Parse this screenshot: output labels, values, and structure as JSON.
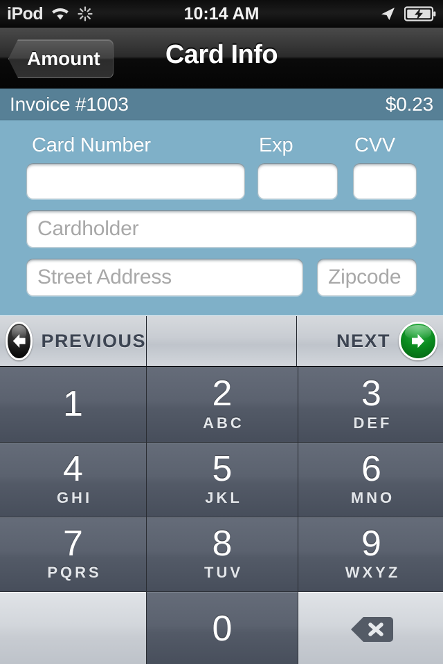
{
  "status_bar": {
    "carrier": "iPod",
    "wifi_icon": "wifi-icon",
    "activity_icon": "activity-spinner-icon",
    "time": "10:14 AM",
    "location_icon": "location-arrow-icon",
    "battery_icon": "battery-charging-icon"
  },
  "nav_bar": {
    "back_label": "Amount",
    "title": "Card Info"
  },
  "invoice": {
    "number": "Invoice #1003",
    "amount": "$0.23"
  },
  "form": {
    "labels": {
      "card_number": "Card Number",
      "exp": "Exp",
      "cvv": "CVV"
    },
    "fields": {
      "card_number_value": "",
      "card_number_placeholder": "",
      "exp_value": "",
      "exp_placeholder": "",
      "cvv_value": "",
      "cvv_placeholder": "",
      "cardholder_value": "",
      "cardholder_placeholder": "Cardholder",
      "street_value": "",
      "street_placeholder": "Street Address",
      "zip_value": "",
      "zip_placeholder": "Zipcode"
    }
  },
  "keyboard_toolbar": {
    "previous_label": "PREVIOUS",
    "previous_icon": "arrow-left-circle-icon",
    "next_label": "NEXT",
    "next_icon": "arrow-right-circle-icon"
  },
  "keypad": {
    "keys": [
      {
        "digit": "1",
        "letters": ""
      },
      {
        "digit": "2",
        "letters": "ABC"
      },
      {
        "digit": "3",
        "letters": "DEF"
      },
      {
        "digit": "4",
        "letters": "GHI"
      },
      {
        "digit": "5",
        "letters": "JKL"
      },
      {
        "digit": "6",
        "letters": "MNO"
      },
      {
        "digit": "7",
        "letters": "PQRS"
      },
      {
        "digit": "8",
        "letters": "TUV"
      },
      {
        "digit": "9",
        "letters": "WXYZ"
      },
      {
        "digit": "0",
        "letters": ""
      }
    ],
    "blank_label": "",
    "backspace_icon": "backspace-delete-icon"
  },
  "colors": {
    "panel_blue": "#7fb0c8",
    "invoice_blue": "#578096",
    "key_slate": "#5b626f",
    "next_green": "#0a8a1e",
    "nav_black": "#0a0a0a"
  }
}
